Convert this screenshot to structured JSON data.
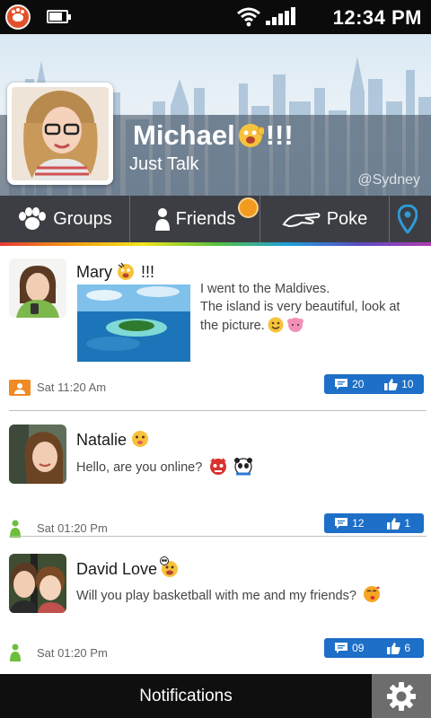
{
  "status_bar": {
    "time": "12:34 PM",
    "battery_level": 0.75,
    "wifi_icon": "wifi-icon",
    "signal_icon": "signal-bars-icon"
  },
  "profile": {
    "name": "Michael",
    "name_suffix": "!!!",
    "status": "Just Talk",
    "location": "@Sydney"
  },
  "tabs": {
    "groups_label": "Groups",
    "friends_label": "Friends",
    "poke_label": "Poke",
    "friends_badge_color": "#f29a1f",
    "location_icon": "location-pin-icon"
  },
  "feed": [
    {
      "name": "Mary",
      "name_suffix": "!!!",
      "text": "I went to the Maldives.\nThe island is very beautiful, look at the picture.",
      "time": "Sat 11:20 Am",
      "comments": "20",
      "likes": "10"
    },
    {
      "name": "Natalie",
      "text": "Hello, are you online?",
      "time": "Sat 01:20 Pm",
      "comments": "12",
      "likes": "1"
    },
    {
      "name": "David Love",
      "text": "Will you play basketball with me and my friends?",
      "time": "Sat 01:20 Pm",
      "comments": "09",
      "likes": "6"
    }
  ],
  "bottom_bar": {
    "notifications_label": "Notifications",
    "settings_icon": "gear-icon"
  },
  "colors": {
    "accent_blue": "#1d6fc7",
    "tab_bar": "#3c3e44",
    "online_green": "#6cbf3a",
    "away_orange": "#f08a24"
  }
}
